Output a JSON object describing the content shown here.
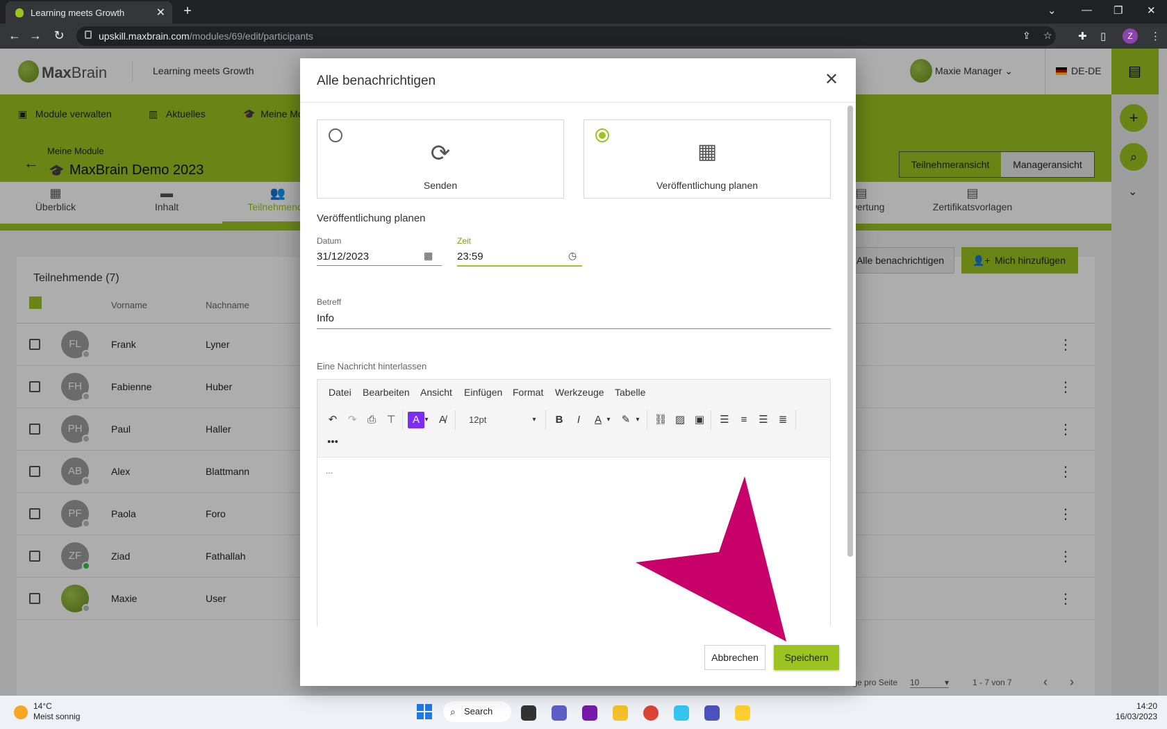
{
  "browser": {
    "tab_title": "Learning meets Growth",
    "url_host": "upskill.maxbrain.com",
    "url_path": "/modules/69/edit/participants",
    "profile_initial": "Z"
  },
  "app": {
    "logo_text_bold": "Max",
    "logo_text_rest": "Brain",
    "tagline": "Learning meets Growth",
    "user_name": "Maxie Manager",
    "language": "DE-DE",
    "nav": [
      "Module verwalten",
      "Aktuelles",
      "Meine Module"
    ],
    "breadcrumb": "Meine Module",
    "module_title": "MaxBrain Demo 2023",
    "view_participant": "Teilnehmeransicht",
    "view_manager": "Manageransicht",
    "tabs": [
      "Überblick",
      "Inhalt",
      "Teilnehmende",
      "Bewertung",
      "Zertifikatsvorlagen"
    ],
    "card_title": "Teilnehmende (7)",
    "notify_all": "Alle benachrichtigen",
    "add_me": "Mich hinzufügen",
    "columns": {
      "first": "Vorname",
      "last": "Nachname"
    },
    "rows": [
      {
        "initials": "FL",
        "first": "Frank",
        "last": "Lyner"
      },
      {
        "initials": "FH",
        "first": "Fabienne",
        "last": "Huber"
      },
      {
        "initials": "PH",
        "first": "Paul",
        "last": "Haller"
      },
      {
        "initials": "AB",
        "first": "Alex",
        "last": "Blattmann"
      },
      {
        "initials": "PF",
        "first": "Paola",
        "last": "Foro"
      },
      {
        "initials": "ZF",
        "first": "Ziad",
        "last": "Fathallah"
      },
      {
        "initials": "",
        "first": "Maxie",
        "last": "User"
      }
    ],
    "per_page_label": "Einträge pro Seite",
    "per_page_value": "10",
    "range": "1 - 7 von 7"
  },
  "modal": {
    "title": "Alle benachrichtigen",
    "option_send": "Senden",
    "option_schedule": "Veröffentlichung planen",
    "section_title": "Veröffentlichung planen",
    "date_label": "Datum",
    "date_value": "31/12/2023",
    "time_label": "Zeit",
    "time_value": "23:59",
    "subject_label": "Betreff",
    "subject_value": "Info",
    "message_label": "Eine Nachricht hinterlassen",
    "menu": [
      "Datei",
      "Bearbeiten",
      "Ansicht",
      "Einfügen",
      "Format",
      "Werkzeuge",
      "Tabelle"
    ],
    "font_size": "12pt",
    "cancel": "Abbrechen",
    "save": "Speichern"
  },
  "taskbar": {
    "temp": "14°C",
    "weather": "Meist sonnig",
    "search": "Search",
    "time": "14:20",
    "date": "16/03/2023"
  },
  "colors": {
    "brand_green": "#9cc421",
    "arrow_magenta": "#c8006a",
    "active_tool": "#7b2cf5"
  }
}
